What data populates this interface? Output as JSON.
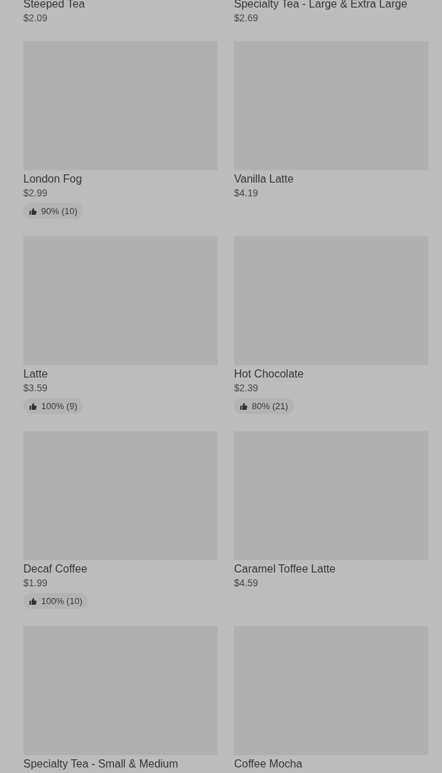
{
  "products": [
    {
      "name": "Steeped Tea",
      "price": "$2.09",
      "image": false
    },
    {
      "name": "Specialty Tea - Large & Extra Large",
      "price": "$2.69",
      "image": false
    },
    {
      "name": "London Fog",
      "price": "$2.99",
      "image": true,
      "rating": "90% (10)"
    },
    {
      "name": "Vanilla Latte",
      "price": "$4.19",
      "image": true
    },
    {
      "name": "Latte",
      "price": "$3.59",
      "image": true,
      "rating": "100% (9)"
    },
    {
      "name": "Hot Chocolate",
      "price": "$2.39",
      "image": true,
      "rating": "80% (21)"
    },
    {
      "name": "Decaf Coffee",
      "price": "$1.99",
      "image": true,
      "rating": "100% (10)"
    },
    {
      "name": "Caramel Toffee Latte",
      "price": "$4.59",
      "image": true
    },
    {
      "name": "Specialty Tea - Small & Medium",
      "image": true
    },
    {
      "name": "Coffee Mocha",
      "image": true
    }
  ]
}
